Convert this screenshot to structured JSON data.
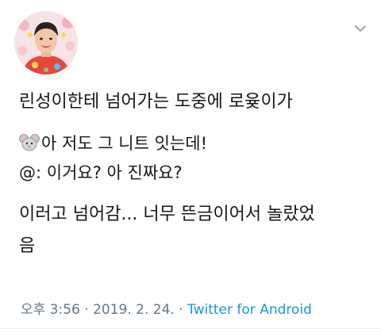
{
  "tweet": {
    "avatar_icon": "profile-avatar",
    "menu_icon": "chevron-down-icon",
    "lines": [
      "린성이한테 넘어가는 도중에 로윶이가",
      "아 저도 그 니트 잇는데!",
      "@: 이거요? 아 진짜요?",
      "이러고 넘어감... 너무 뜬금이어서 놀랐었",
      "음"
    ],
    "emoji_icon": "mouse-face-icon",
    "time": "오후 3:56",
    "separator": " · ",
    "date": "2019. 2. 24.",
    "source": "Twitter for Android",
    "colors": {
      "text": "#14171a",
      "meta": "#657786",
      "link": "#1b95e0"
    }
  }
}
